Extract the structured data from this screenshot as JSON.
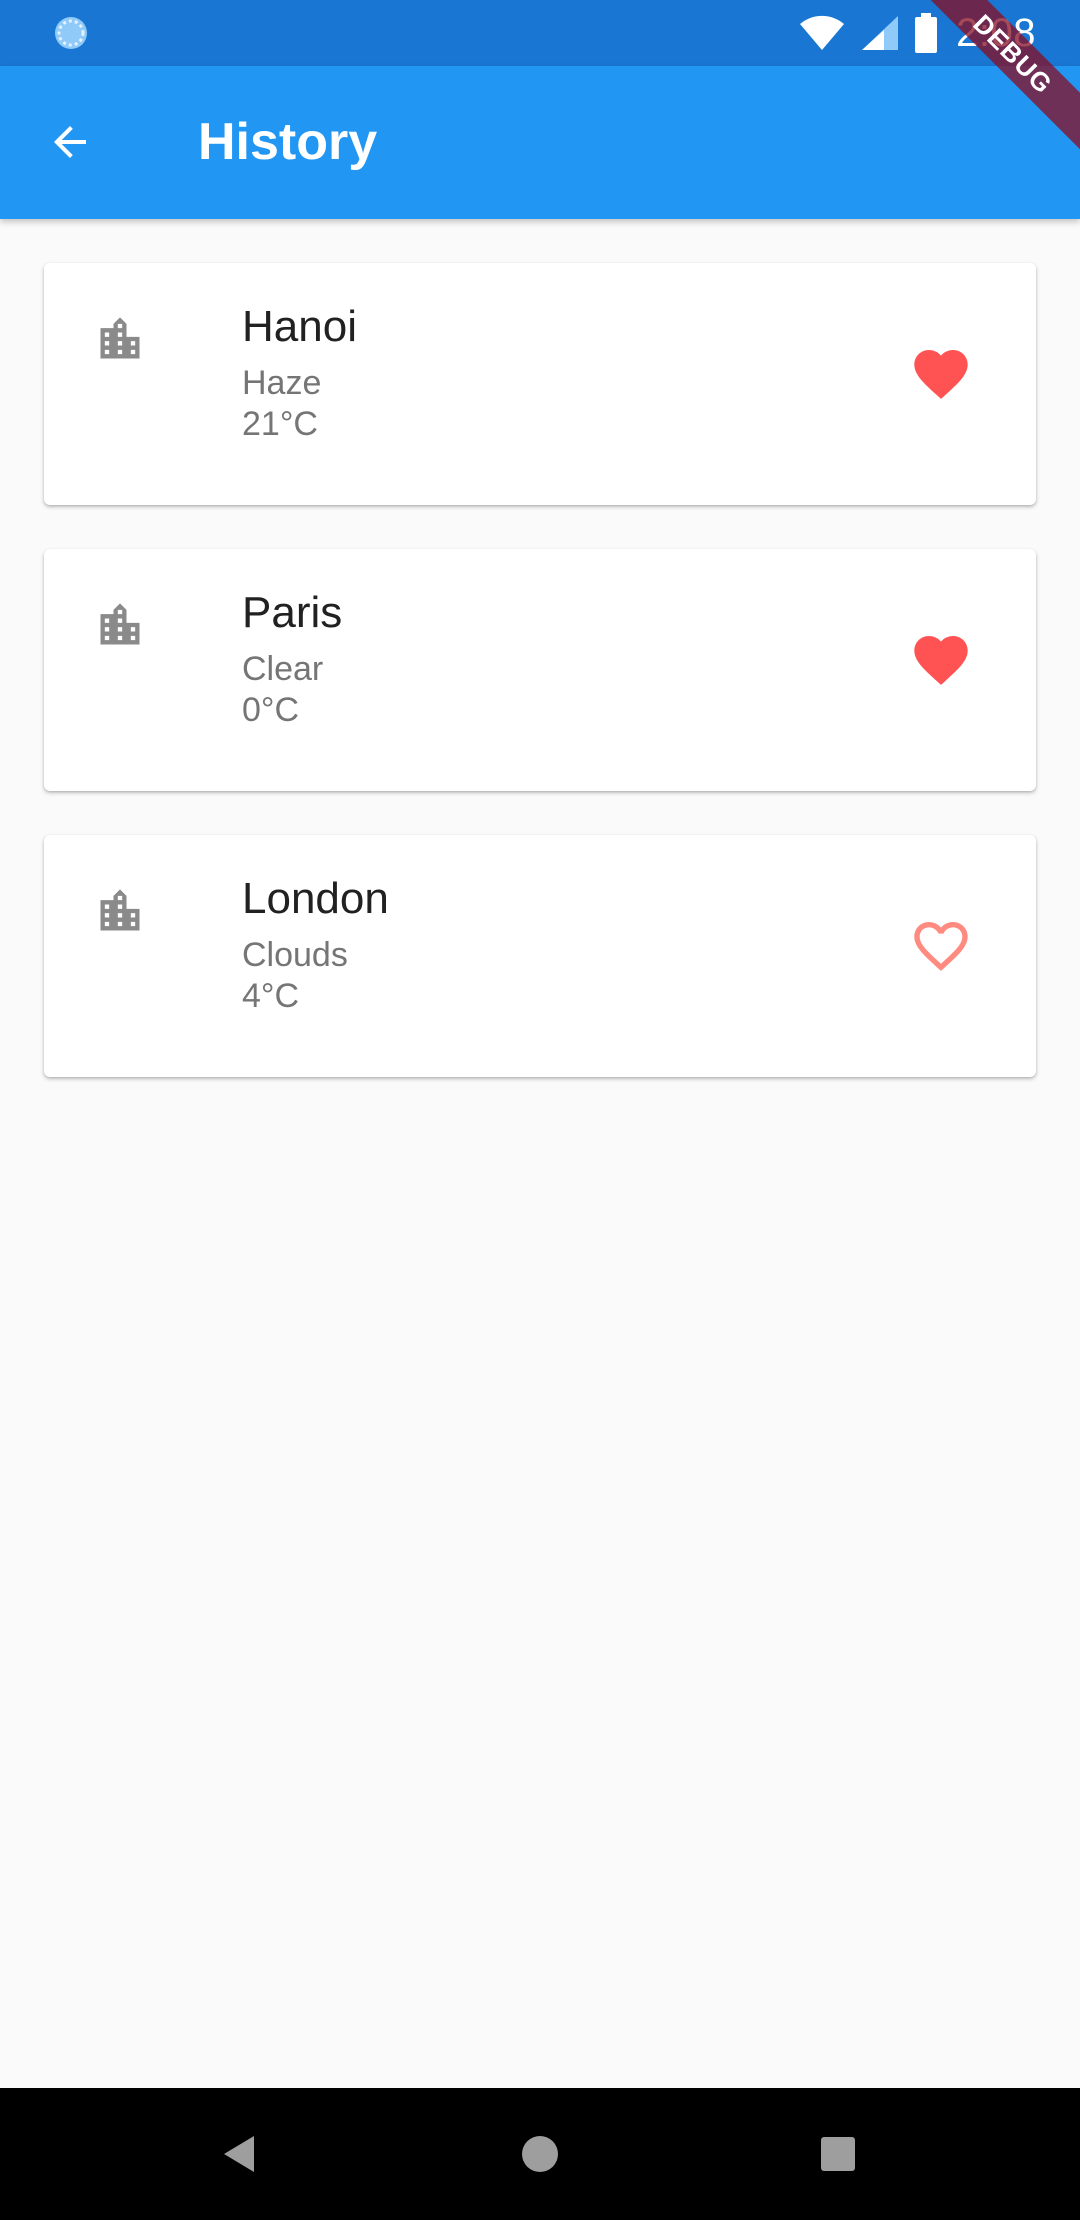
{
  "status_bar": {
    "time": "2:08",
    "background": "#1976d2"
  },
  "app_bar": {
    "title": "History",
    "background": "#2196f3",
    "back_icon": "arrow-back-icon"
  },
  "debug_banner": "DEBUG",
  "history": [
    {
      "city": "Hanoi",
      "description": "Haze",
      "temperature": "21°C",
      "favorite": true
    },
    {
      "city": "Paris",
      "description": "Clear",
      "temperature": "0°C",
      "favorite": true
    },
    {
      "city": "London",
      "description": "Clouds",
      "temperature": "4°C",
      "favorite": false
    }
  ],
  "colors": {
    "favorite": "#ff5252",
    "favorite_outline": "#ff8a80",
    "city_icon": "#8a8a8a"
  },
  "icons": {
    "city": "location-city-icon",
    "favorite_filled": "heart-filled-icon",
    "favorite_outline": "heart-outline-icon"
  }
}
